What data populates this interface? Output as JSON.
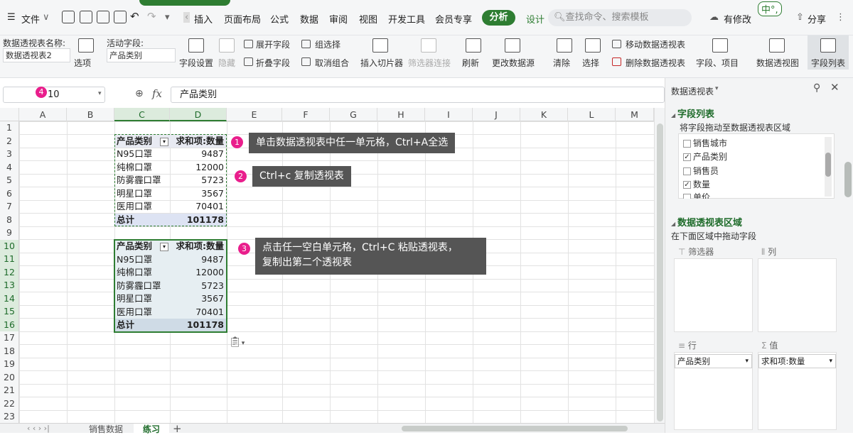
{
  "menubar": {
    "file": "文件",
    "items": [
      "插入",
      "页面布局",
      "公式",
      "数据",
      "审阅",
      "视图",
      "开发工具",
      "会员专享"
    ],
    "active_tab": "分析",
    "design_tab": "设计",
    "search_placeholder": "查找命令、搜索模板",
    "modified": "有修改",
    "share": "分享",
    "ime": "中°,",
    "accent": "#2e7d32"
  },
  "ribbon": {
    "pivot_name_label": "数据透视表名称:",
    "pivot_name_value": "数据透视表2",
    "options": "选项",
    "active_field_label": "活动字段:",
    "active_field_value": "产品类别",
    "field_settings": "字段设置",
    "hide": "隐藏",
    "expand_field": "展开字段",
    "collapse_field": "折叠字段",
    "group_select": "组选择",
    "ungroup": "取消组合",
    "insert_slicer": "插入切片器",
    "filter_conn": "筛选器连接",
    "refresh": "刷新",
    "change_source": "更改数据源",
    "clear": "清除",
    "select": "选择",
    "move_pivot": "移动数据透视表",
    "delete_pivot": "删除数据透视表",
    "fields_items": "字段、项目",
    "pivot_chart": "数据透视图",
    "field_list": "字段列表"
  },
  "formula": {
    "cell_ref": "10",
    "badge": "4",
    "fx": "fx",
    "content": "产品类别"
  },
  "columns": [
    "A",
    "B",
    "C",
    "D",
    "E",
    "F",
    "G",
    "H",
    "I",
    "J",
    "K",
    "L",
    "M"
  ],
  "rows": [
    "1",
    "2",
    "3",
    "4",
    "5",
    "6",
    "7",
    "8",
    "9",
    "10",
    "11",
    "12",
    "13",
    "14",
    "15",
    "16",
    "17",
    "18",
    "19",
    "20",
    "21",
    "22",
    "23"
  ],
  "pivot1": {
    "header_c": "产品类别",
    "header_d": "求和项:数量",
    "items": [
      {
        "name": "N95口罩",
        "value": "9487"
      },
      {
        "name": "纯棉口罩",
        "value": "12000"
      },
      {
        "name": "防雾霾口罩",
        "value": "5723"
      },
      {
        "name": "明星口罩",
        "value": "3567"
      },
      {
        "name": "医用口罩",
        "value": "70401"
      }
    ],
    "total_label": "总计",
    "total_value": "101178"
  },
  "pivot2": {
    "header_c": "产品类别",
    "header_d": "求和项:数量",
    "items": [
      {
        "name": "N95口罩",
        "value": "9487"
      },
      {
        "name": "纯棉口罩",
        "value": "12000"
      },
      {
        "name": "防雾霾口罩",
        "value": "5723"
      },
      {
        "name": "明星口罩",
        "value": "3567"
      },
      {
        "name": "医用口罩",
        "value": "70401"
      }
    ],
    "total_label": "总计",
    "total_value": "101178"
  },
  "callouts": [
    {
      "badge": "1",
      "text": "单击数据透视表中任一单元格，Ctrl+A全选"
    },
    {
      "badge": "2",
      "text": "Ctrl+c  复制透视表"
    },
    {
      "badge": "3",
      "line1": "点击任一空白单元格，Ctrl+C  粘贴透视表，",
      "line2": "复制出第二个透视表"
    }
  ],
  "sheets": [
    "销售数据",
    "练习"
  ],
  "pane": {
    "title": "数据透视表",
    "field_list_title": "字段列表",
    "field_list_hint": "将字段拖动至数据透视表区域",
    "fields": [
      {
        "name": "销售城市",
        "checked": false
      },
      {
        "name": "产品类别",
        "checked": true
      },
      {
        "name": "销售员",
        "checked": false
      },
      {
        "name": "数量",
        "checked": true
      },
      {
        "name": "单价",
        "checked": false
      }
    ],
    "areas_title": "数据透视表区域",
    "areas_hint": "在下面区域中拖动字段",
    "filter_zone": "筛选器",
    "col_zone": "列",
    "row_zone": "行",
    "val_zone": "值",
    "row_field": "产品类别",
    "val_field": "求和项:数量"
  }
}
